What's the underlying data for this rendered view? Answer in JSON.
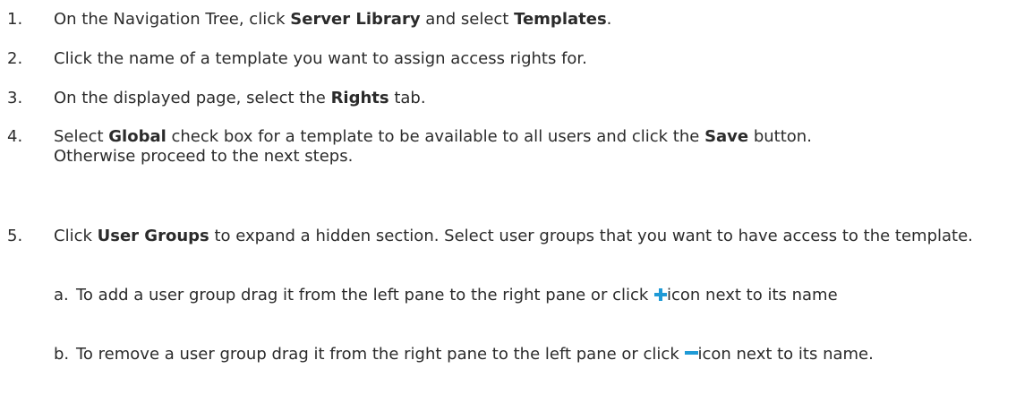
{
  "steps": [
    {
      "number": "1.",
      "t1": "On the Navigation Tree, click ",
      "b1": "Server Library",
      "t2": " and select ",
      "b2": "Templates",
      "t3": "."
    },
    {
      "number": "2.",
      "t1": "Click the name of a template you want to assign access rights for."
    },
    {
      "number": "3.",
      "t1": "On the displayed page, select the ",
      "b1": "Rights",
      "t2": " tab."
    },
    {
      "number": "4.",
      "t1": "Select ",
      "b1": "Global",
      "t2": " check box for a template to be available to all users and click the ",
      "b2": "Save",
      "t3": " button.",
      "t4": "Otherwise proceed to the next steps."
    },
    {
      "number": "5.",
      "t1": "Click ",
      "b1": "User Groups",
      "t2": " to expand a hidden section. Select user groups that you want to have access to the template.",
      "substeps": [
        {
          "letter": "a.",
          "t1": "To add a user group drag it from the left pane to the right pane or click ",
          "icon": "plus-icon",
          "t2": "icon next to its name"
        },
        {
          "letter": "b.",
          "t1": "To remove a user group drag it from the right pane to the left  pane or click ",
          "icon": "minus-icon",
          "t2": "icon next to its name."
        }
      ]
    }
  ]
}
